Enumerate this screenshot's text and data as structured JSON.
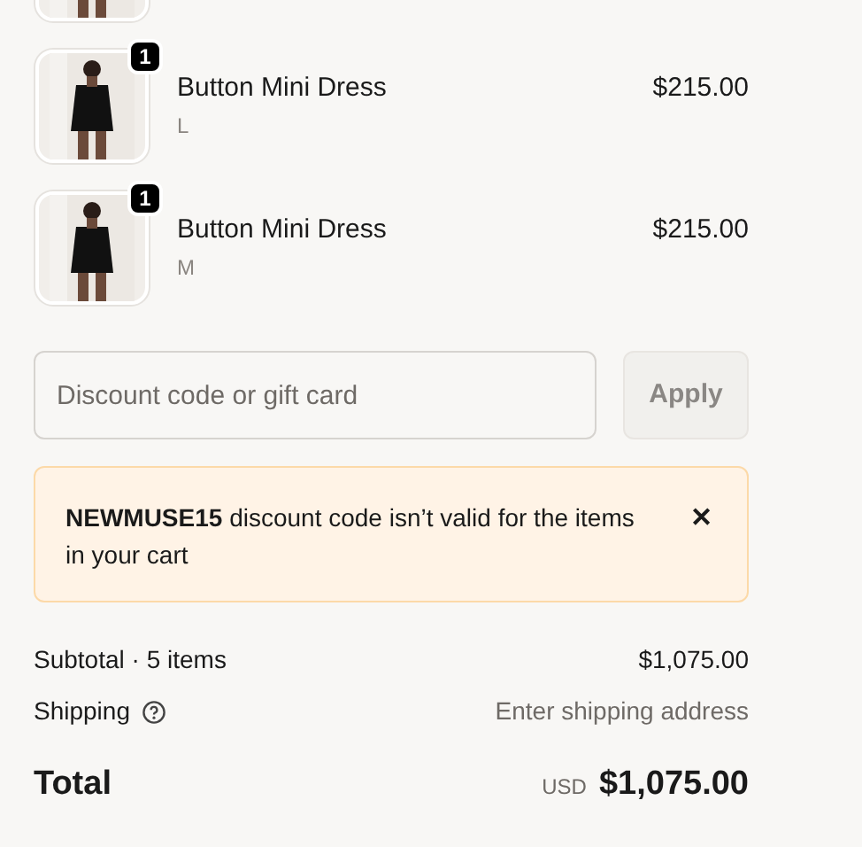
{
  "items": [
    {
      "kind": "partial"
    },
    {
      "kind": "full",
      "quantity": "1",
      "name": "Button Mini Dress",
      "variant": "L",
      "price": "$215.00"
    },
    {
      "kind": "full",
      "quantity": "1",
      "name": "Button Mini Dress",
      "variant": "M",
      "price": "$215.00"
    }
  ],
  "discount": {
    "placeholder": "Discount code or gift card",
    "button": "Apply"
  },
  "alert": {
    "message": "**NEWMUSE15** discount code isn’t valid for the items in your cart",
    "close": "✕"
  },
  "summary": {
    "subtotal_label": "Subtotal · 5 items",
    "subtotal": "$1,075.00",
    "shipping_label": "Shipping",
    "shipping": "Enter shipping address",
    "total_label": "Total",
    "currency": "USD",
    "total": "$1,075.00"
  }
}
